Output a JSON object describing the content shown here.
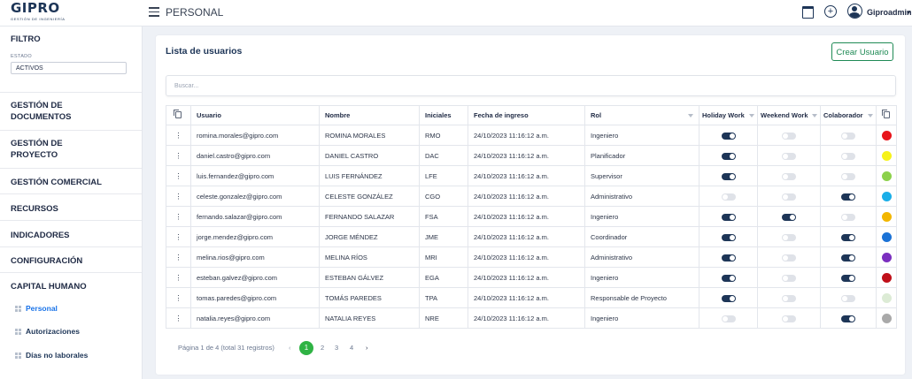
{
  "header": {
    "brand": "GIPRO",
    "brand_tagline": "GESTIÓN DE INGENIERÍA",
    "page_title": "PERSONAL",
    "username": "Giproadmin"
  },
  "sidebar": {
    "filter_title": "FILTRO",
    "filter_label": "ESTADO",
    "filter_value": "ACTIVOS",
    "sections": [
      "GESTIÓN DE DOCUMENTOS",
      "GESTIÓN DE PROYECTO",
      "GESTIÓN COMERCIAL",
      "RECURSOS",
      "INDICADORES",
      "CONFIGURACIÓN",
      "CAPITAL HUMANO"
    ],
    "sub_items": [
      "Personal",
      "Autorizaciones",
      "Días no laborales"
    ]
  },
  "main": {
    "card_title": "Lista de usuarios",
    "create_button": "Crear Usuario",
    "search_placeholder": "Buscar..."
  },
  "table": {
    "columns": [
      "Usuario",
      "Nombre",
      "Iniciales",
      "Fecha de ingreso",
      "Rol",
      "Holiday Work",
      "Weekend Work",
      "Colaborador"
    ],
    "rows": [
      {
        "usuario": "romina.morales@gipro.com",
        "nombre": "ROMINA MORALES",
        "iniciales": "RMO",
        "fecha": "24/10/2023 11:16:12 a.m.",
        "rol": "Ingeniero",
        "holiday": true,
        "weekend": false,
        "colaborador": false,
        "color": "#e8141b"
      },
      {
        "usuario": "daniel.castro@gipro.com",
        "nombre": "DANIEL CASTRO",
        "iniciales": "DAC",
        "fecha": "24/10/2023 11:16:12 a.m.",
        "rol": "Planificador",
        "holiday": true,
        "weekend": false,
        "colaborador": false,
        "color": "#f6f21a"
      },
      {
        "usuario": "luis.fernandez@gipro.com",
        "nombre": "LUIS FERNÁNDEZ",
        "iniciales": "LFE",
        "fecha": "24/10/2023 11:16:12 a.m.",
        "rol": "Supervisor",
        "holiday": true,
        "weekend": false,
        "colaborador": false,
        "color": "#8cd14b"
      },
      {
        "usuario": "celeste.gonzalez@gipro.com",
        "nombre": "CELESTE GONZÁLEZ",
        "iniciales": "CGO",
        "fecha": "24/10/2023 11:16:12 a.m.",
        "rol": "Administrativo",
        "holiday": false,
        "weekend": false,
        "colaborador": true,
        "color": "#1aaee8"
      },
      {
        "usuario": "fernando.salazar@gipro.com",
        "nombre": "FERNANDO SALAZAR",
        "iniciales": "FSA",
        "fecha": "24/10/2023 11:16:12 a.m.",
        "rol": "Ingeniero",
        "holiday": true,
        "weekend": true,
        "colaborador": false,
        "color": "#f2b600"
      },
      {
        "usuario": "jorge.mendez@gipro.com",
        "nombre": "JORGE MÉNDEZ",
        "iniciales": "JME",
        "fecha": "24/10/2023 11:16:12 a.m.",
        "rol": "Coordinador",
        "holiday": true,
        "weekend": false,
        "colaborador": true,
        "color": "#1b72d6"
      },
      {
        "usuario": "melina.rios@gipro.com",
        "nombre": "MELINA RÍOS",
        "iniciales": "MRI",
        "fecha": "24/10/2023 11:16:12 a.m.",
        "rol": "Administrativo",
        "holiday": true,
        "weekend": false,
        "colaborador": true,
        "color": "#7b2fbf"
      },
      {
        "usuario": "esteban.galvez@gipro.com",
        "nombre": "ESTEBAN GÁLVEZ",
        "iniciales": "EGA",
        "fecha": "24/10/2023 11:16:12 a.m.",
        "rol": "Ingeniero",
        "holiday": true,
        "weekend": false,
        "colaborador": true,
        "color": "#c0101a"
      },
      {
        "usuario": "tomas.paredes@gipro.com",
        "nombre": "TOMÁS PAREDES",
        "iniciales": "TPA",
        "fecha": "24/10/2023 11:16:12 a.m.",
        "rol": "Responsable de Proyecto",
        "holiday": true,
        "weekend": false,
        "colaborador": false,
        "color": "#dcebd5"
      },
      {
        "usuario": "natalia.reyes@gipro.com",
        "nombre": "NATALIA REYES",
        "iniciales": "NRE",
        "fecha": "24/10/2023 11:16:12 a.m.",
        "rol": "Ingeniero",
        "holiday": false,
        "weekend": false,
        "colaborador": true,
        "color": "#a9a9a9"
      }
    ]
  },
  "pagination": {
    "summary": "Página 1 de 4 (total 31 registros)",
    "prev": "‹",
    "next": "›",
    "pages": [
      "1",
      "2",
      "3",
      "4"
    ],
    "current": "1"
  },
  "colors": {
    "brand_navy": "#1d3557",
    "active_link": "#1a73e8",
    "create_green": "#1f8a55",
    "page_active_green": "#2fb344",
    "toggle_on": "#1d3557",
    "toggle_off": "#dfe2e8"
  }
}
